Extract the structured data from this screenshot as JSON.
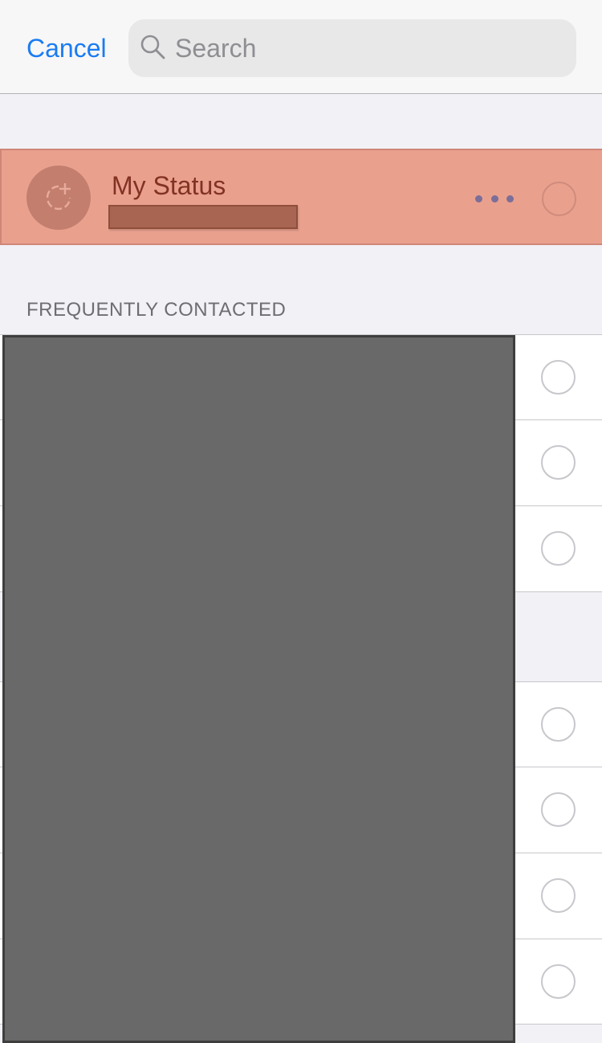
{
  "header": {
    "cancel_label": "Cancel",
    "search": {
      "placeholder": "Search",
      "value": "",
      "icon": "search-icon"
    }
  },
  "my_status": {
    "title": "My Status",
    "subtitle": "[redacted]",
    "avatar_icon": "add-status-icon",
    "more_icon": "more-horizontal-icon",
    "selected": false,
    "highlight_color": "#e9a18e"
  },
  "sections": [
    {
      "header": "FREQUENTLY CONTACTED",
      "rows": [
        {
          "name": "[redacted]",
          "selected": false
        },
        {
          "name": "[redacted]",
          "selected": false
        },
        {
          "name": "[redacted]",
          "selected": false
        }
      ]
    },
    {
      "header": "",
      "rows": [
        {
          "name": "[redacted]",
          "selected": false
        },
        {
          "name": "[redacted]",
          "selected": false
        },
        {
          "name": "[redacted]",
          "selected": false
        },
        {
          "name": "[redacted]",
          "selected": false
        }
      ]
    }
  ],
  "colors": {
    "accent": "#1a7cf2",
    "background": "#f1f1f6",
    "row": "#ffffff",
    "separator": "#c8c7cc",
    "redaction": "#696969"
  }
}
